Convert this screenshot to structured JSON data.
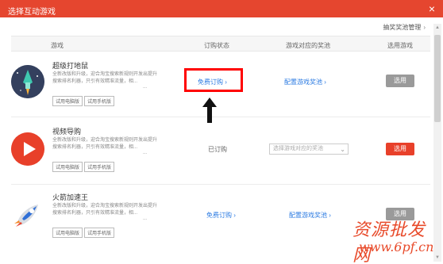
{
  "window": {
    "title": "选择互动游戏",
    "close_glyph": "×"
  },
  "toolbar": {
    "manage_label": "抽奖奖池管理",
    "manage_chevron": "›"
  },
  "table": {
    "headers": [
      "游戏",
      "订购状态",
      "游戏对应的奖池",
      "选用游戏"
    ]
  },
  "games": [
    {
      "name": "超级打地鼠",
      "description": "全新改版和升级，迎合淘宝搜索新规则开发出提升搜索排名利器，只引有效精准流量，相...",
      "more": "...",
      "tags": [
        "试用电脑版",
        "试用手机版"
      ],
      "order_status": "免费订购",
      "order_chevron": "›",
      "prize_pool": "配置游戏奖池",
      "prize_chevron": "›",
      "select_label": "选用",
      "icon": "rocket-ship-icon"
    },
    {
      "name": "视频导购",
      "description": "全新改版和升级，迎合淘宝搜索新规则开发出提升搜索排名利器，只引有效精准流量，相...",
      "more": "...",
      "tags": [
        "试用电脑版",
        "试用手机版"
      ],
      "order_status": "已订购",
      "prize_pool_placeholder": "选择游戏对应的奖池",
      "select_label": "选用",
      "icon": "play-icon"
    },
    {
      "name": "火箭加速王",
      "description": "全新改版和升级，迎合淘宝搜索新规则开发出提升搜索排名利器，只引有效精准流量，相...",
      "more": "...",
      "tags": [
        "试用电脑版",
        "试用手机版"
      ],
      "order_status": "免费订购",
      "order_chevron": "›",
      "prize_pool": "配置游戏奖池",
      "prize_chevron": "›",
      "select_label": "选用",
      "icon": "rocket-icon"
    }
  ],
  "watermark": {
    "chinese": "资源批发网",
    "url": "www.6pf.cn"
  },
  "colors": {
    "brand_red": "#e5462f",
    "link_blue": "#2a7ae2",
    "button_gray": "#9a9a9a",
    "highlight_red": "#ff0000"
  }
}
